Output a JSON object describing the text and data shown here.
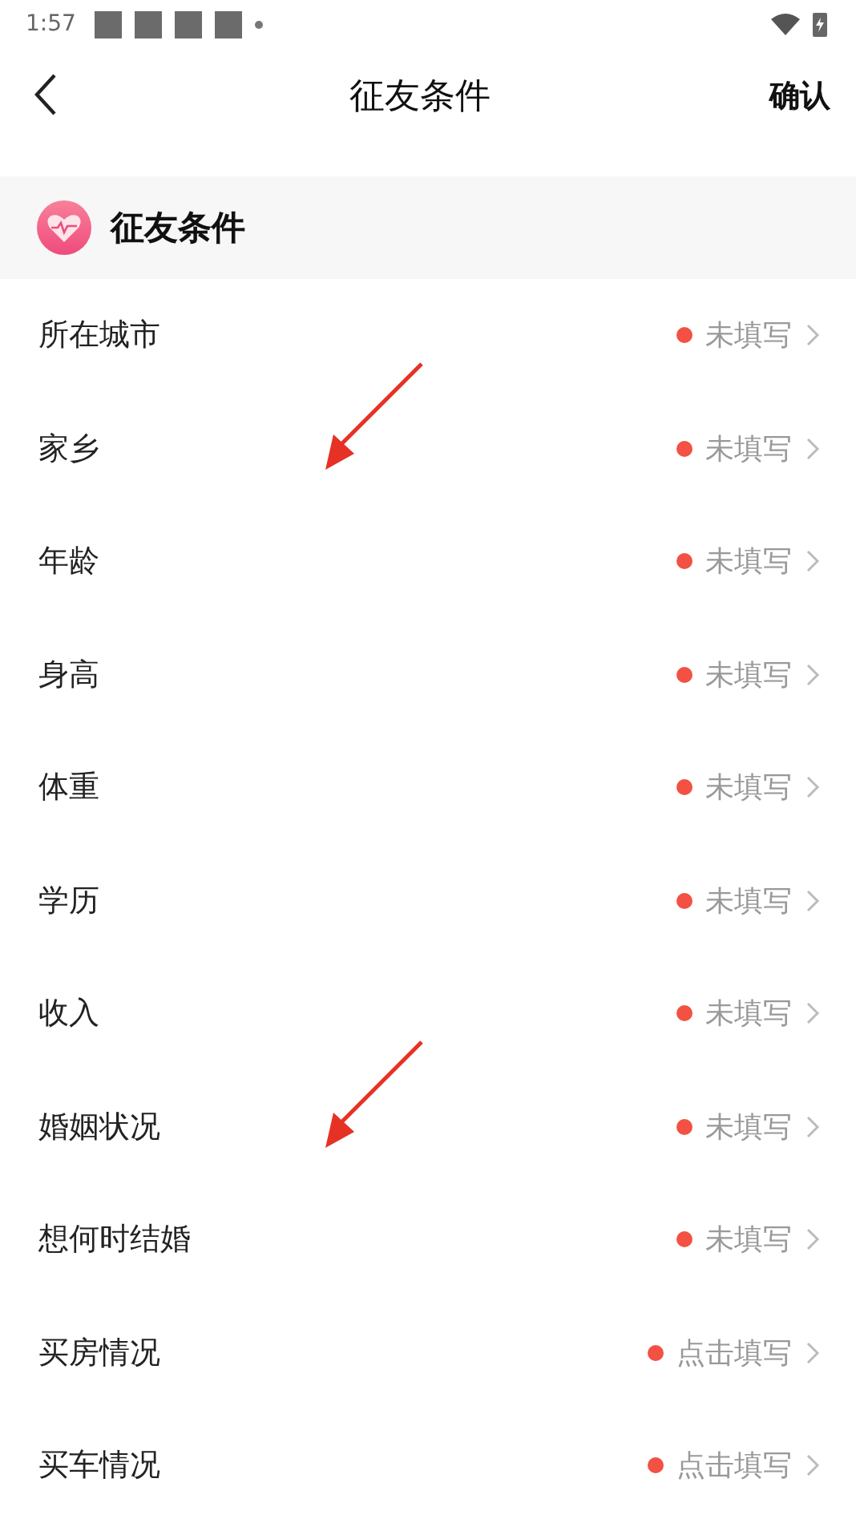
{
  "status_bar": {
    "time": "1:57"
  },
  "header": {
    "title": "征友条件",
    "action": "确认"
  },
  "section": {
    "title": "征友条件"
  },
  "rows": [
    {
      "label": "所在城市",
      "status": "未填写",
      "arrow": false
    },
    {
      "label": "家乡",
      "status": "未填写",
      "arrow": true
    },
    {
      "label": "年龄",
      "status": "未填写",
      "arrow": false
    },
    {
      "label": "身高",
      "status": "未填写",
      "arrow": false
    },
    {
      "label": "体重",
      "status": "未填写",
      "arrow": false
    },
    {
      "label": "学历",
      "status": "未填写",
      "arrow": false
    },
    {
      "label": "收入",
      "status": "未填写",
      "arrow": false
    },
    {
      "label": "婚姻状况",
      "status": "未填写",
      "arrow": true
    },
    {
      "label": "想何时结婚",
      "status": "未填写",
      "arrow": false
    },
    {
      "label": "买房情况",
      "status": "点击填写",
      "arrow": false
    },
    {
      "label": "买车情况",
      "status": "点击填写",
      "arrow": false
    }
  ]
}
